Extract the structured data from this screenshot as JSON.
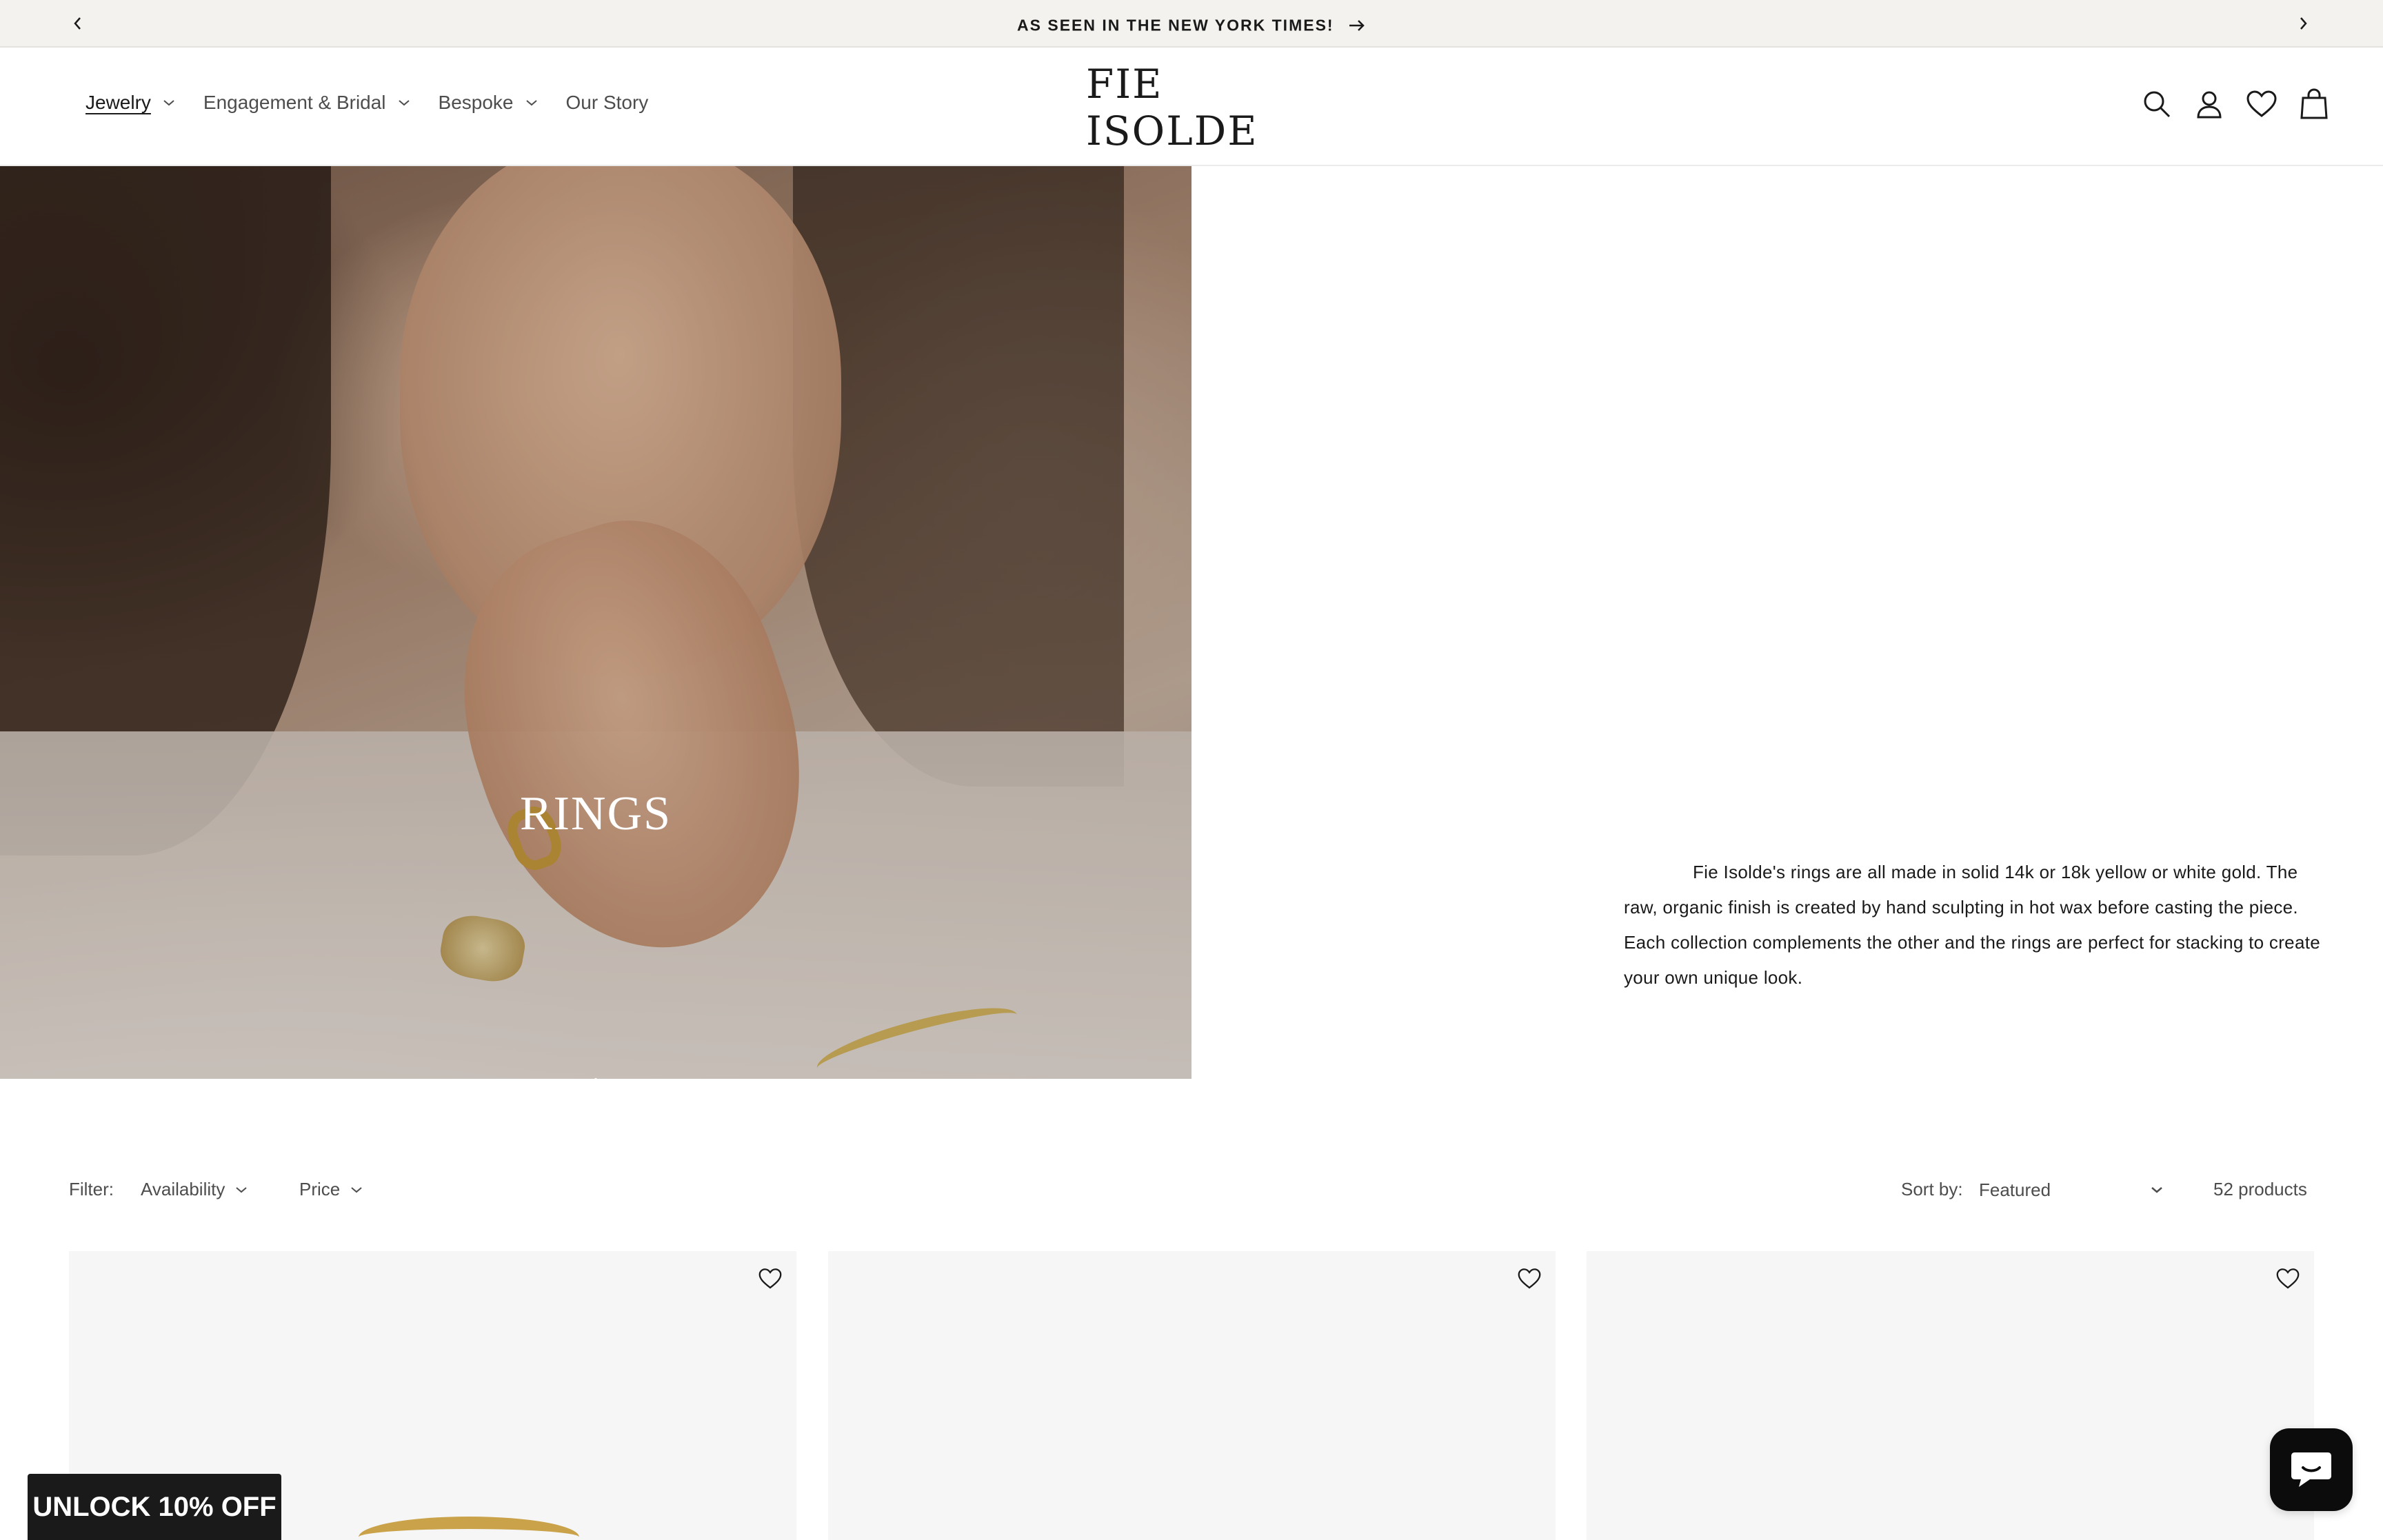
{
  "announcement": {
    "message": "AS SEEN IN THE NEW YORK TIMES!"
  },
  "header": {
    "logo": "FIE ISOLDE",
    "nav": [
      {
        "label": "Jewelry",
        "active": true
      },
      {
        "label": "Engagement & Bridal"
      },
      {
        "label": "Bespoke"
      },
      {
        "label": "Our Story"
      }
    ],
    "icons": [
      "search-icon",
      "account-icon",
      "wishlist-heart-icon",
      "cart-bag-icon"
    ]
  },
  "hero": {
    "title": "RINGS",
    "description": "Fie Isolde's rings are all made in solid 14k or 18k yellow or white gold. The raw, organic finish is created by hand sculpting in hot wax before casting the piece. Each collection complements the other and the rings are perfect for stacking to create your own unique look."
  },
  "filters": {
    "filter_label": "Filter:",
    "availability": "Availability",
    "price": "Price",
    "sort_label": "Sort by:",
    "sort_value": "Featured",
    "product_count": "52 products"
  },
  "popup": {
    "unlock": "UNLOCK 10% OFF"
  },
  "colors": {
    "announcement_bg": "#f3f2ee",
    "text": "#1a1a1a",
    "card_bg": "#f6f6f6",
    "popup_bg": "#1a1a1a"
  }
}
